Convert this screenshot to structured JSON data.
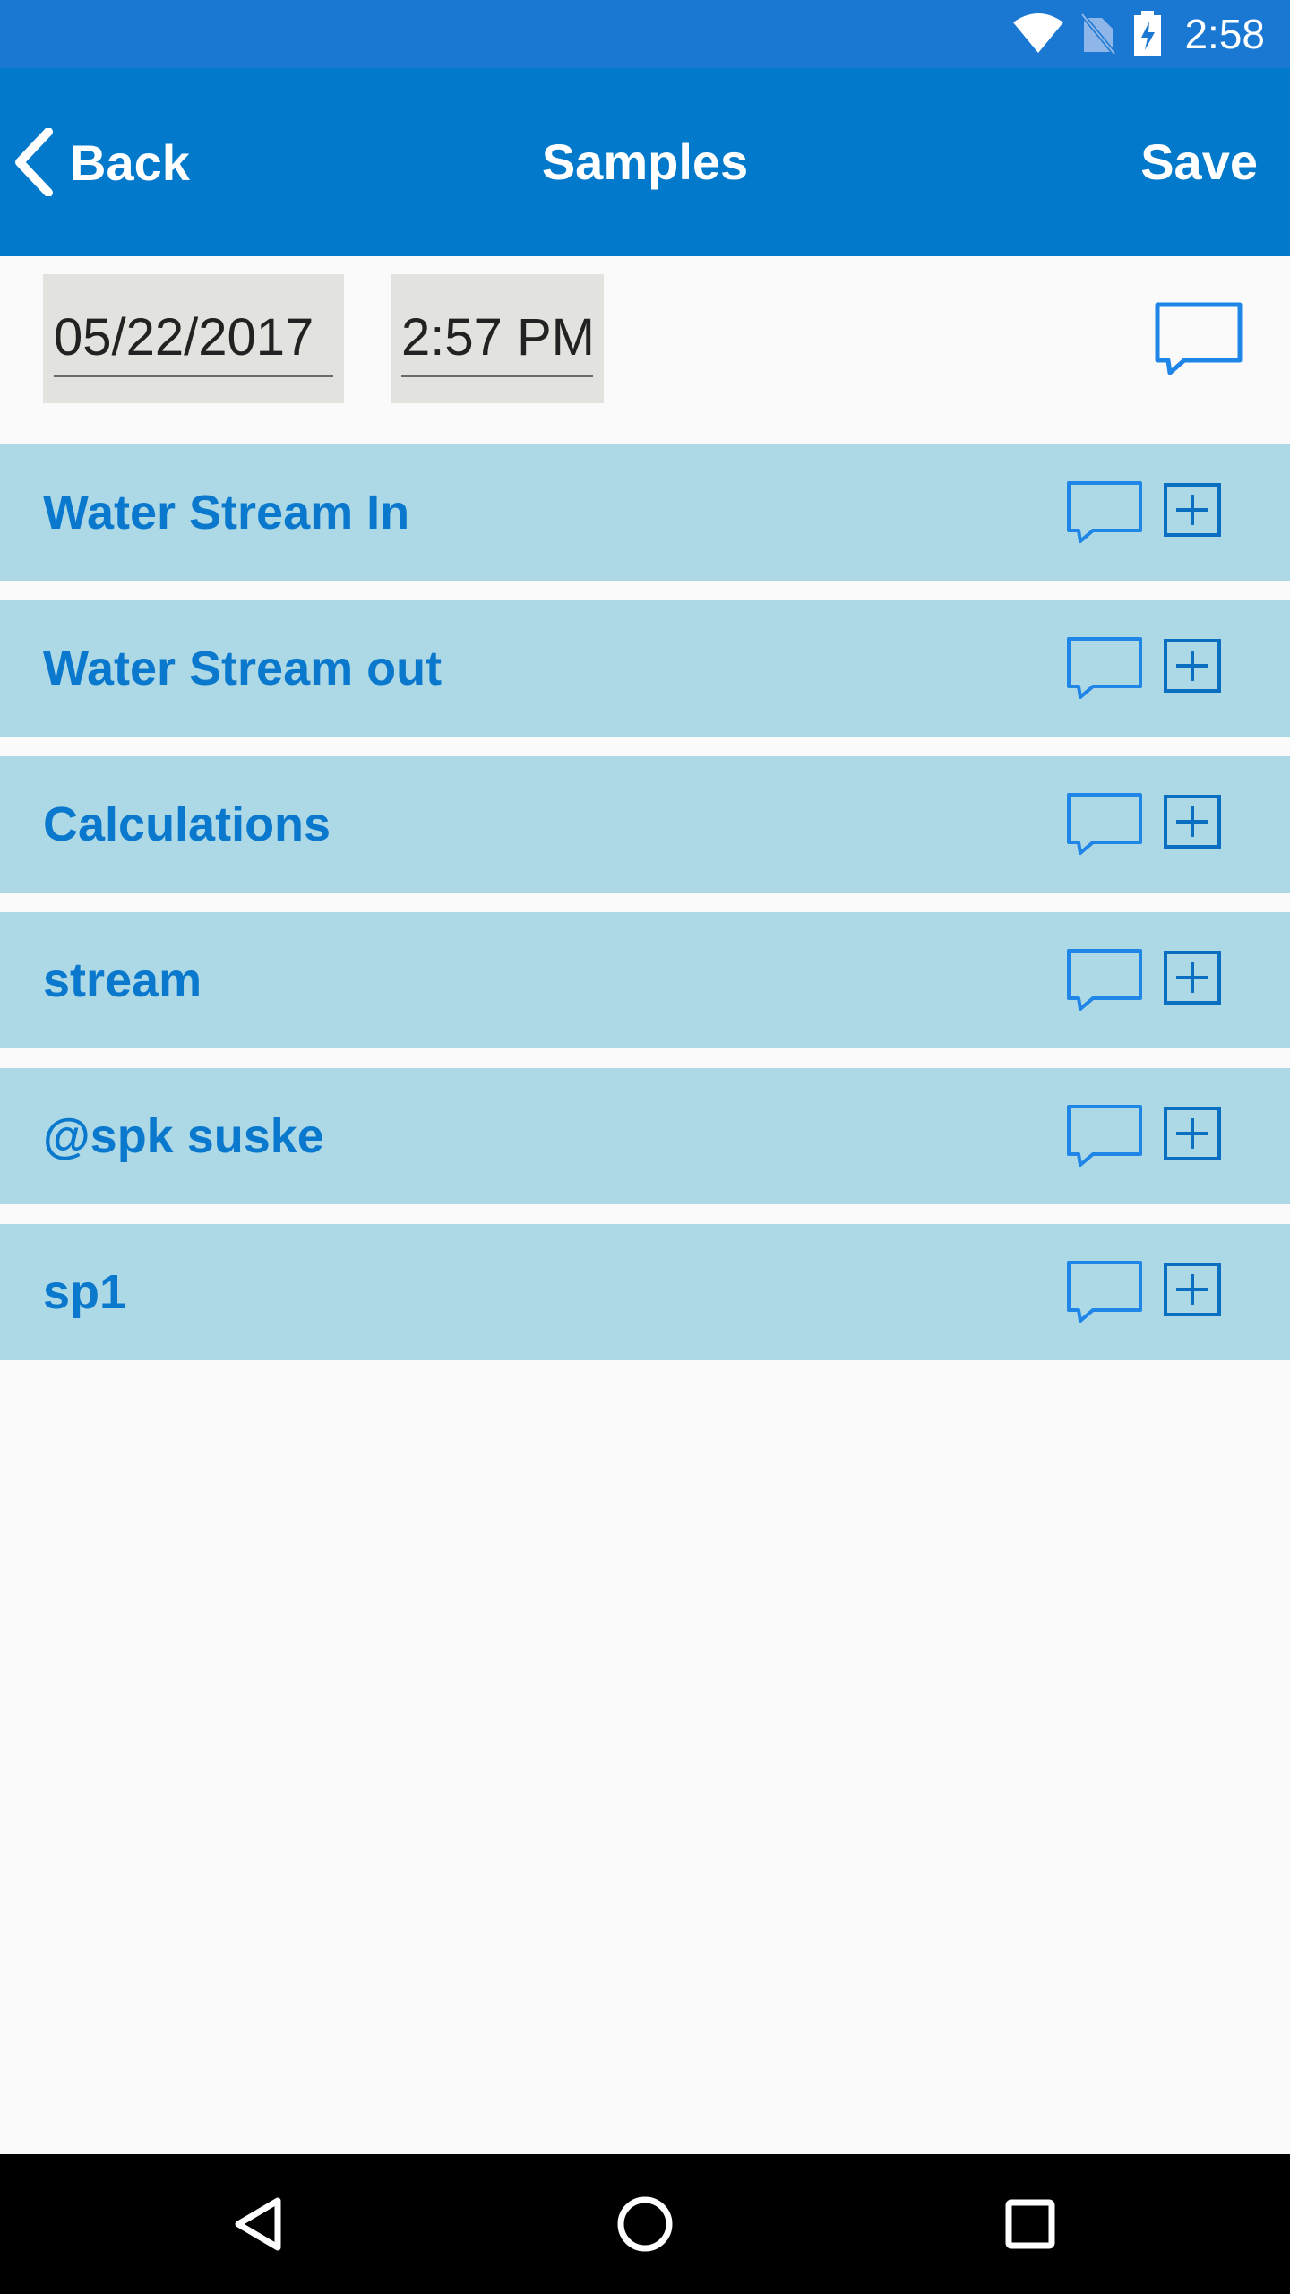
{
  "status_bar": {
    "time": "2:58",
    "icons": [
      "wifi-icon",
      "no-sim-icon",
      "battery-charging-icon"
    ]
  },
  "app_bar": {
    "back_label": "Back",
    "title": "Samples",
    "save_label": "Save"
  },
  "header": {
    "date": "05/22/2017",
    "time": "2:57 PM"
  },
  "sections": [
    {
      "label": "Water Stream In"
    },
    {
      "label": "Water Stream out"
    },
    {
      "label": "Calculations"
    },
    {
      "label": "stream"
    },
    {
      "label": "@spk suske"
    },
    {
      "label": "sp1"
    }
  ],
  "colors": {
    "status_bar": "#1b78d2",
    "app_bar": "#0379cc",
    "section_bg": "#add8e6",
    "section_text": "#0a78cc",
    "field_bg": "#e2e2de"
  },
  "nav_bar": {
    "icons": [
      "back-triangle-icon",
      "home-circle-icon",
      "recents-square-icon"
    ]
  }
}
